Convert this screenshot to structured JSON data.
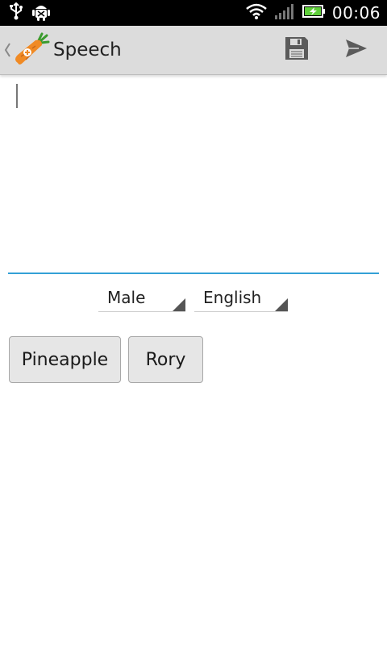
{
  "status_bar": {
    "time": "00:06",
    "icons": [
      "usb-icon",
      "android-debug-icon",
      "wifi-icon",
      "signal-icon",
      "battery-charging-icon"
    ]
  },
  "action_bar": {
    "title": "Speech",
    "actions": [
      "save-icon",
      "send-icon"
    ]
  },
  "speech_input": {
    "value": "",
    "accent_color": "#33a0d6"
  },
  "spinners": {
    "voice": "Male",
    "language": "English"
  },
  "phrases": [
    "Pineapple",
    "Rory"
  ]
}
